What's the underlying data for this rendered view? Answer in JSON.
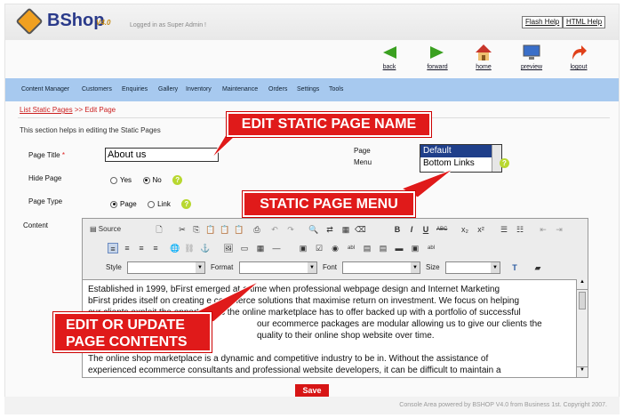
{
  "header": {
    "brand": "BShop",
    "version": "V4.0",
    "logged_in": "Logged in as Super Admin !",
    "flash_help": "Flash Help",
    "html_help": "HTML Help"
  },
  "nav": {
    "back": "back",
    "forward": "forward",
    "home": "home",
    "preview": "preview",
    "logout": "logout"
  },
  "menu": [
    "Content Manager",
    "Customers",
    "Enquiries",
    "Gallery",
    "Inventory",
    "Maintenance",
    "Orders",
    "Settings",
    "Tools"
  ],
  "breadcrumb": {
    "list": "List Static Pages",
    "sep": ">>",
    "current": "Edit Page"
  },
  "help_text": "This section helps in editing the Static Pages",
  "form": {
    "page_title_label": "Page Title",
    "required": "*",
    "page_title_value": "About us",
    "hide_page_label": "Hide Page",
    "yes": "Yes",
    "no": "No",
    "page_type_label": "Page Type",
    "page": "Page",
    "link": "Link",
    "content_label": "Content",
    "page_menu_label_1": "Page",
    "page_menu_label_2": "Menu",
    "menu_options": [
      "Default",
      "Bottom Links"
    ],
    "help_mark": "?"
  },
  "editor": {
    "source": "Source",
    "style": "Style",
    "format": "Format",
    "font": "Font",
    "size": "Size",
    "content_lines": [
      "Established in 1999, bFirst emerged at a time when professional webpage design and Internet Marketing",
      "bFirst prides itself on creating e commerce solutions that maximise return on investment. We focus on helping",
      "our clients exploit the opportunities the online marketplace has to offer backed up with a portfolio of successful",
      "our ecommerce packages are modular allowing us to give our clients the",
      "quality to their online shop website over time.",
      "",
      "The online shop marketplace is a dynamic and competitive industry to be in. Without the assistance of",
      "experienced ecommerce consultants and professional website developers, it can be difficult to maintain a"
    ]
  },
  "save_label": "Save",
  "footer": "Console Area powered by BSHOP V4.0 from Business 1st. Copyright 2007.",
  "callouts": {
    "name": "EDIT STATIC PAGE NAME",
    "menu": "STATIC PAGE MENU",
    "contents_1": "EDIT OR UPDATE",
    "contents_2": "PAGE CONTENTS"
  },
  "colors": {
    "accent": "#e01a1a",
    "menubar": "#a7c9ef",
    "brand": "#2a3a8a"
  }
}
